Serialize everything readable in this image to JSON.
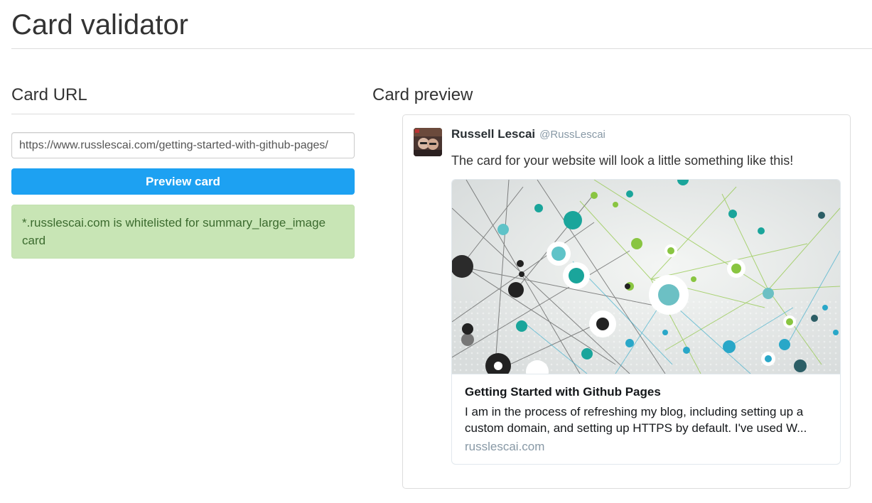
{
  "page": {
    "title": "Card validator"
  },
  "card_url_section": {
    "heading": "Card URL",
    "url_value": "https://www.russlescai.com/getting-started-with-github-pages/",
    "preview_button_label": "Preview card",
    "status_message": "*.russlescai.com is whitelisted for summary_large_image card"
  },
  "card_preview_section": {
    "heading": "Card preview",
    "tweet": {
      "author_name": "Russell Lescai",
      "author_handle": "@RussLescai",
      "text": "The card for your website will look a little something like this!",
      "card": {
        "image_description_icon": "network-graph-image",
        "title": "Getting Started with Github Pages",
        "description": "I am in the process of refreshing my blog, including setting up a custom domain, and setting up HTTPS by default. I've used W...",
        "domain": "russlescai.com"
      }
    }
  },
  "colors": {
    "button_blue": "#1da1f2",
    "success_bg": "#c8e5b5",
    "success_text": "#3c6b2f",
    "handle_gray": "#8899a6"
  }
}
